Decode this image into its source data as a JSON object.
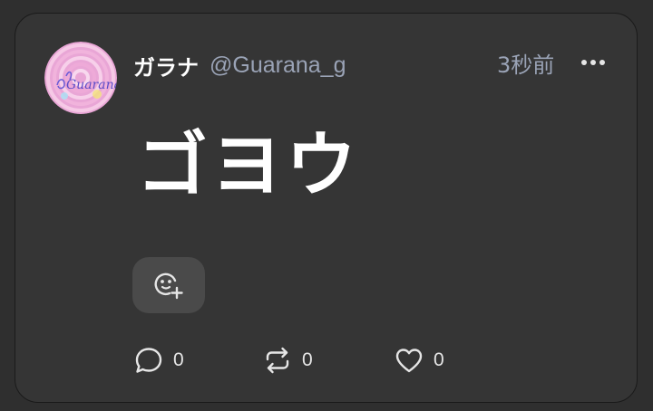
{
  "post": {
    "author": {
      "display_name": "ガラナ",
      "handle": "@Guarana_g",
      "avatar_icon": "avatar-spiral-logo",
      "avatar_text": "Guarana"
    },
    "time": "3秒前",
    "text": "ゴヨウ",
    "reaction_button_icon": "add-reaction-icon",
    "actions": {
      "reply_count": "0",
      "renote_count": "0",
      "like_count": "0"
    }
  },
  "colors": {
    "background": "#2f2f2f",
    "card": "#353535",
    "muted_text": "#9aa3b6",
    "text": "#ffffff",
    "reaction_button": "#4a4a4a"
  }
}
